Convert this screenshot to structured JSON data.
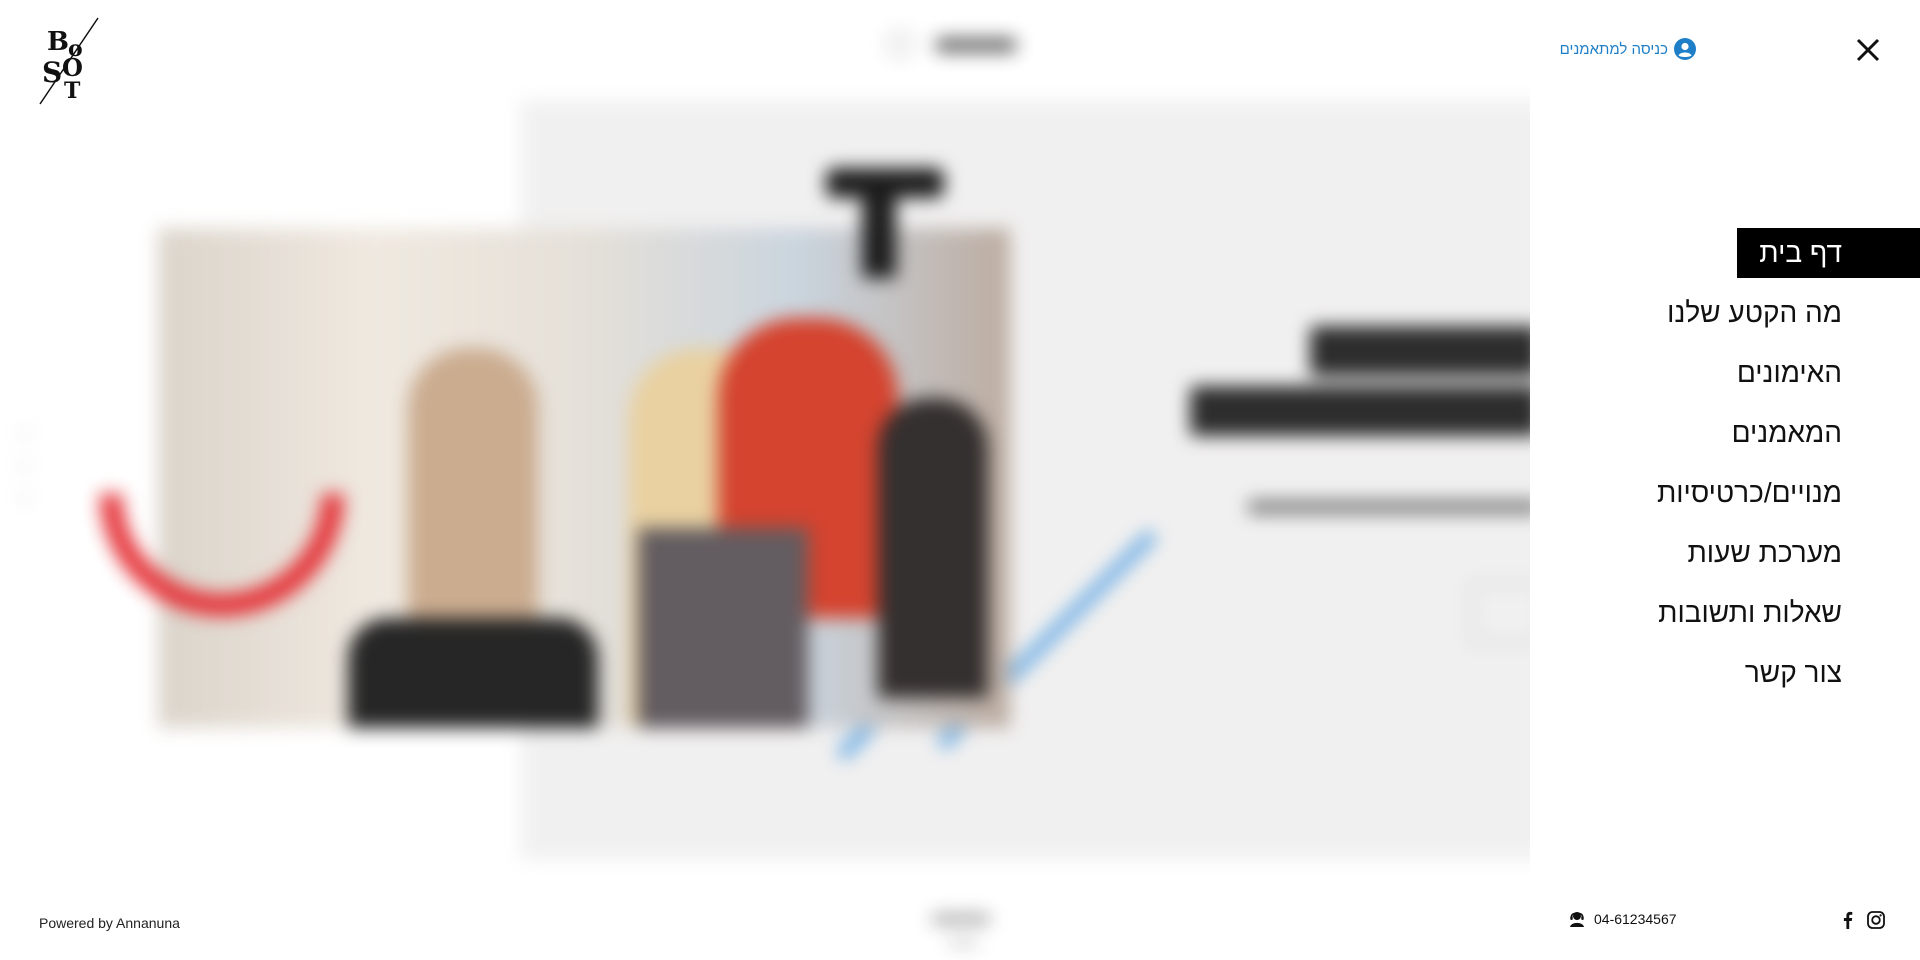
{
  "header": {
    "logo_name": "boost-logo",
    "login_label": "כניסה למתאמנים",
    "close_icon": "close-icon",
    "login_icon": "user-circle-icon"
  },
  "menu": {
    "items": [
      {
        "label": "דף בית",
        "active": true
      },
      {
        "label": "מה הקטע שלנו",
        "active": false
      },
      {
        "label": "האימונים",
        "active": false
      },
      {
        "label": "המאמנים",
        "active": false
      },
      {
        "label": "מנויים/כרטיסיות",
        "active": false
      },
      {
        "label": "מערכת שעות",
        "active": false
      },
      {
        "label": "שאלות ותשובות",
        "active": false
      },
      {
        "label": "צור קשר",
        "active": false
      }
    ]
  },
  "footer": {
    "powered_by": "Powered by Annanuna",
    "phone": "04-61234567",
    "phone_icon": "phone-user-icon",
    "social": [
      "facebook-icon",
      "instagram-icon"
    ]
  },
  "colors": {
    "accent": "#1e7fc8",
    "active_bg": "#000000",
    "ring": "#e3262c",
    "slash": "#4a9be0"
  }
}
